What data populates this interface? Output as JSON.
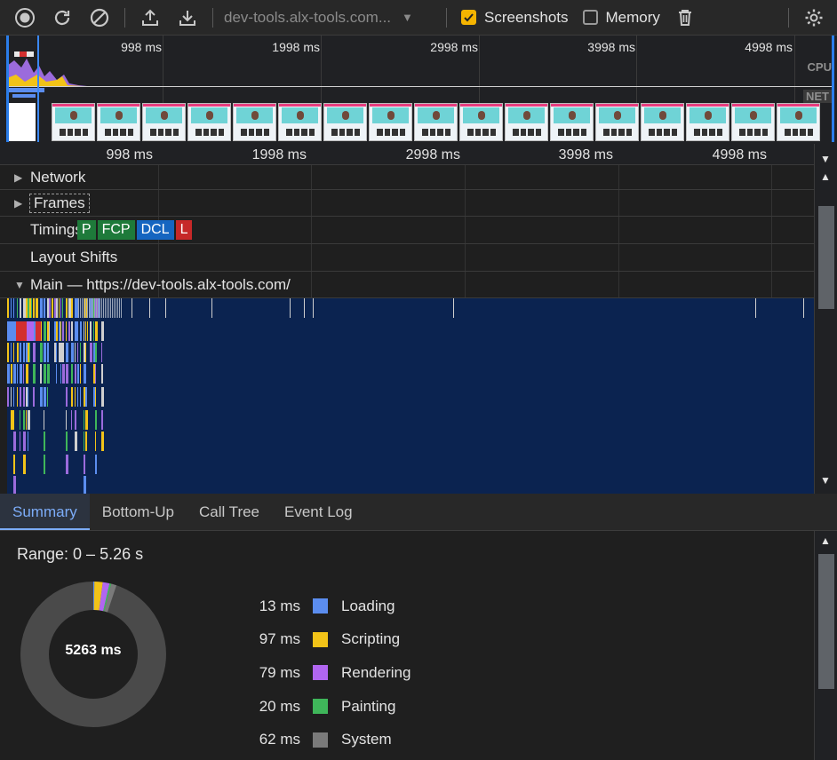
{
  "toolbar": {
    "url": "dev-tools.alx-tools.com...",
    "screenshots_label": "Screenshots",
    "screenshots_checked": true,
    "memory_label": "Memory",
    "memory_checked": false
  },
  "overview": {
    "ticks": [
      "998 ms",
      "1998 ms",
      "2998 ms",
      "3998 ms",
      "4998 ms"
    ],
    "cpu_label": "CPU",
    "net_label": "NET",
    "screenshot_count": 17
  },
  "timeline": {
    "ticks": [
      "998 ms",
      "1998 ms",
      "2998 ms",
      "3998 ms",
      "4998 ms"
    ],
    "tracks": {
      "network": "Network",
      "frames": "Frames",
      "timings": "Timings",
      "layout_shifts": "Layout Shifts",
      "main": "Main — https://dev-tools.alx-tools.com/"
    },
    "timing_markers": [
      {
        "label": "P",
        "color": "#1e7a3a"
      },
      {
        "label": "FCP",
        "color": "#1e7a3a"
      },
      {
        "label": "DCL",
        "color": "#1565c0"
      },
      {
        "label": "L",
        "color": "#c62828"
      }
    ]
  },
  "tabs": [
    "Summary",
    "Bottom-Up",
    "Call Tree",
    "Event Log"
  ],
  "active_tab": "Summary",
  "summary": {
    "range": "Range: 0 – 5.26 s",
    "total": "5263 ms",
    "items": [
      {
        "value": "13 ms",
        "label": "Loading",
        "color": "#5b8def",
        "ms": 13
      },
      {
        "value": "97 ms",
        "label": "Scripting",
        "color": "#f2c318",
        "ms": 97
      },
      {
        "value": "79 ms",
        "label": "Rendering",
        "color": "#b166f0",
        "ms": 79
      },
      {
        "value": "20 ms",
        "label": "Painting",
        "color": "#3fb65a",
        "ms": 20
      },
      {
        "value": "62 ms",
        "label": "System",
        "color": "#7a7a7a",
        "ms": 62
      }
    ],
    "idle_color": "#4a4a4a"
  }
}
